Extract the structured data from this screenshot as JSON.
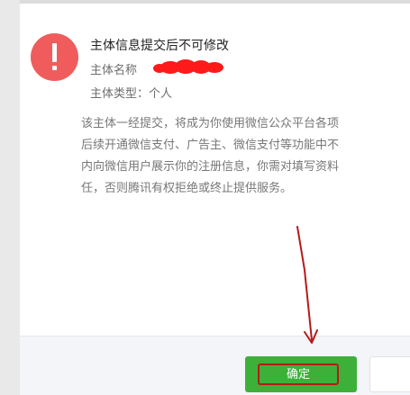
{
  "dialog": {
    "title": "主体信息提交后不可修改",
    "subject_name_label": "主体名称",
    "subject_type_label": "主体类型：个人",
    "description_lines": [
      "该主体一经提交，将成为你使用微信公众平台各项",
      "后续开通微信支付、广告主、微信支付等功能中不",
      "内向微信用户展示你的注册信息，你需对填写资料",
      "任，否则腾讯有权拒绝或终止提供服务。"
    ],
    "confirm_label": "确定",
    "cancel_label": ""
  },
  "icons": {
    "warning": "exclamation-icon"
  },
  "colors": {
    "warning_icon": "#f05c5c",
    "confirm_button": "#3db039",
    "annotation": "#b51a1a",
    "redaction": "#ff1a1a"
  }
}
